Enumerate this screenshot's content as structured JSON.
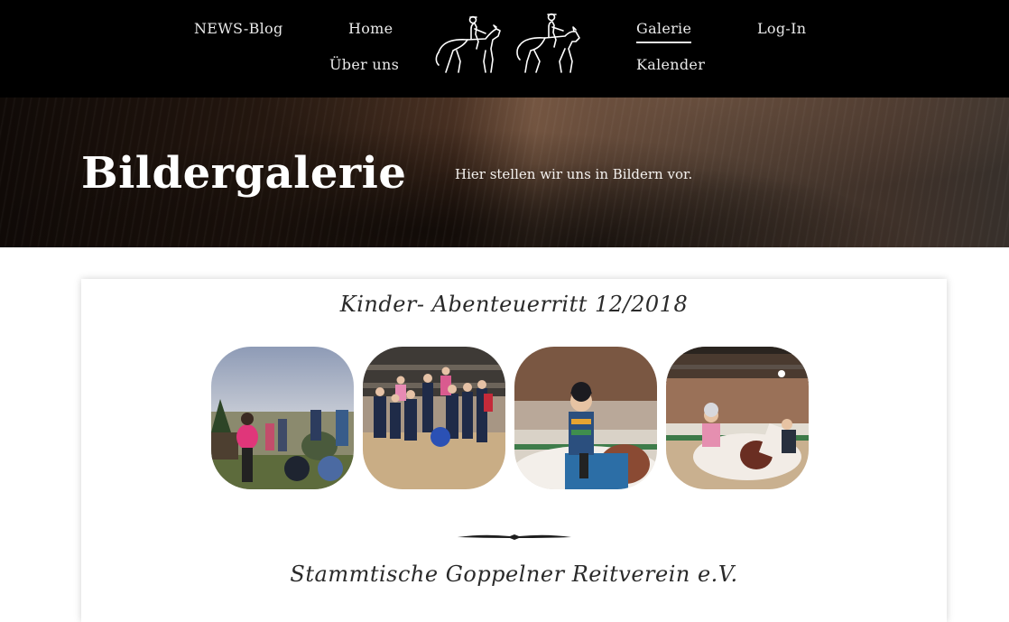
{
  "nav": {
    "news": "NEWS-Blog",
    "home": "Home",
    "ueber": "Über uns",
    "galerie": "Galerie",
    "login": "Log-In",
    "kalender": "Kalender"
  },
  "hero": {
    "title": "Bildergalerie",
    "subtitle": "Hier stellen wir uns in Bildern vor."
  },
  "gallery": {
    "section1_title": "Kinder- Abenteuerritt 12/2018",
    "section2_title": "Stammtische Goppelner Reitverein e.V.",
    "images": [
      "outdoor-group-photo",
      "indoor-group-photo",
      "child-on-pony-photo",
      "child-riding-photo"
    ]
  },
  "colors": {
    "header_bg": "#000000",
    "nav_text": "#e9e9e9",
    "card_bg": "#ffffff"
  }
}
